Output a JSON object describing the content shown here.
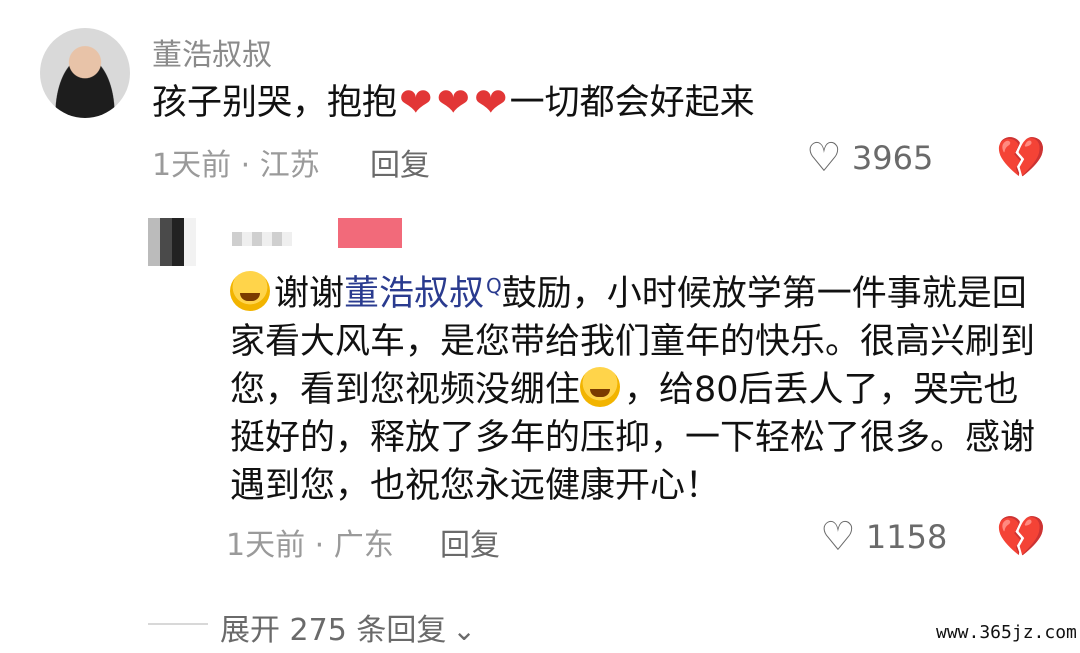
{
  "comment1": {
    "username": "董浩叔叔",
    "text_before": "孩子别哭，抱抱",
    "hearts": [
      "❤",
      "❤",
      "❤"
    ],
    "text_after": "一切都会好起来",
    "meta": "1天前 · 江苏",
    "reply_label": "回复",
    "likes": "3965"
  },
  "comment2": {
    "username_blurred": true,
    "text_prefix": "谢谢",
    "mention": "董浩叔叔",
    "mention_icon": "Q",
    "text_mid1": "鼓励，小时候放学第一件事就是回家看大风车，是您带给我们童年的快乐。很高兴刷到您，看到您视频没绷住",
    "text_mid2": "，给80后丢人了，哭完也挺好的，释放了多年的压抑，一下轻松了很多。感谢遇到您，也祝您永远健康开心！",
    "meta": "1天前 · 广东",
    "reply_label": "回复",
    "likes": "1158"
  },
  "expand": {
    "label": "展开 275 条回复",
    "chevron": "⌄"
  },
  "watermark": "www.365jz.com",
  "icons": {
    "like": "heart-outline-icon",
    "dislike": "broken-heart-icon",
    "emoji": "laughing-crying-emoji-icon"
  },
  "colors": {
    "mention": "#2a3b8f",
    "heart": "#e23636",
    "meta": "#9a9a9a"
  }
}
